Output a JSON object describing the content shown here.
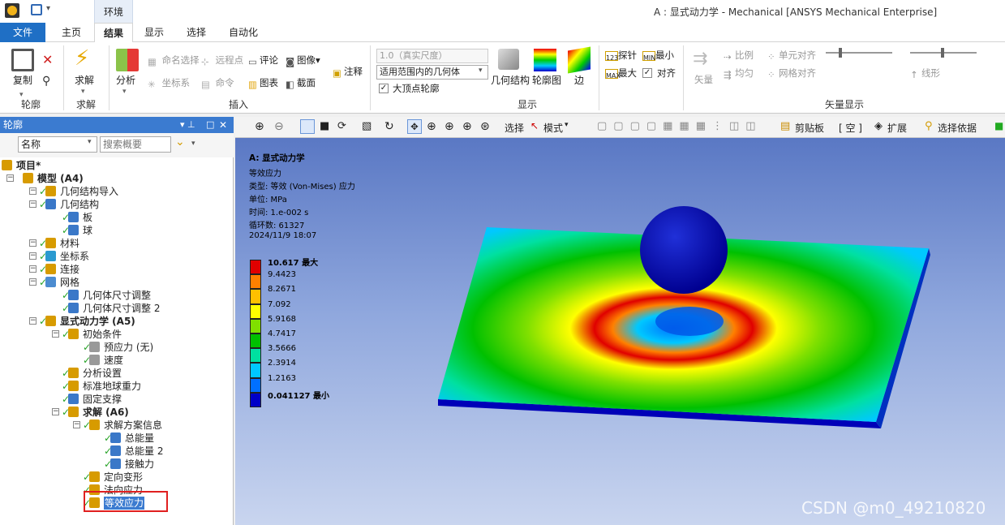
{
  "window": {
    "title": "A : 显式动力学 - Mechanical [ANSYS Mechanical Enterprise]",
    "context_tab": "环境"
  },
  "tabs": [
    "文件",
    "主页",
    "结果",
    "显示",
    "选择",
    "自动化"
  ],
  "ribbon": {
    "copy": "复制",
    "solve": "求解",
    "analyze": "分析",
    "name_select": "命名选择",
    "remote_point": "远程点",
    "comment": "评论",
    "image": "图像",
    "coord": "坐标系",
    "command": "命令",
    "chart": "图表",
    "screenshot": "截面",
    "annotation": "注释",
    "scale_value": "1.0（真实尺度）",
    "scope_value": "适用范围内的几何体",
    "outline_check": "大顶点轮廓",
    "geometry": "几何结构",
    "contour": "轮廓图",
    "edge": "边",
    "probe": "探针",
    "min": "最小",
    "max": "最大",
    "align": "对齐",
    "vector": "矢量",
    "ratio": "比例",
    "uniform": "均匀",
    "element_align": "单元对齐",
    "mesh_align": "网格对齐",
    "linear": "线形",
    "groups": [
      "轮廓",
      "求解",
      "插入",
      "显示",
      "矢量显示"
    ]
  },
  "outline": {
    "title": "轮廓",
    "filter_name": "名称",
    "search_placeholder": "搜索概要",
    "tree": [
      {
        "label": "项目*",
        "bold": true
      },
      {
        "label": "模型 (A4)",
        "bold": true
      },
      {
        "label": "几何结构导入"
      },
      {
        "label": "几何结构"
      },
      {
        "label": "板"
      },
      {
        "label": "球"
      },
      {
        "label": "材料"
      },
      {
        "label": "坐标系"
      },
      {
        "label": "连接"
      },
      {
        "label": "网格"
      },
      {
        "label": "几何体尺寸调整"
      },
      {
        "label": "几何体尺寸调整 2"
      },
      {
        "label": "显式动力学 (A5)",
        "bold": true
      },
      {
        "label": "初始条件"
      },
      {
        "label": "预应力 (无)"
      },
      {
        "label": "速度"
      },
      {
        "label": "分析设置"
      },
      {
        "label": "标准地球重力"
      },
      {
        "label": "固定支撑"
      },
      {
        "label": "求解 (A6)",
        "bold": true
      },
      {
        "label": "求解方案信息"
      },
      {
        "label": "总能量"
      },
      {
        "label": "总能量 2"
      },
      {
        "label": "接触力"
      },
      {
        "label": "定向变形"
      },
      {
        "label": "法向应力"
      },
      {
        "label": "等效应力",
        "selected": true
      }
    ]
  },
  "toolbar": {
    "select": "选择",
    "mode": "模式",
    "clipboard": "剪贴板",
    "empty": "[ 空 ]",
    "expand": "扩展",
    "select_by": "选择依据"
  },
  "result": {
    "title": "A: 显式动力学",
    "name": "等效应力",
    "type": "类型: 等效 (Von-Mises) 应力",
    "unit": "单位: MPa",
    "time": "时间: 1.e-002 s",
    "cycles": "循环数: 61327",
    "date": "2024/11/9 18:07"
  },
  "legend": {
    "labels": [
      "10.617 最大",
      "9.4423",
      "8.2671",
      "7.092",
      "5.9168",
      "4.7417",
      "3.5666",
      "2.3914",
      "1.2163",
      "0.041127 最小"
    ],
    "colors": [
      "#e00000",
      "#ff8000",
      "#ffc000",
      "#ffff00",
      "#80e000",
      "#00c000",
      "#00e0a0",
      "#00c8ff",
      "#0070ff",
      "#0000c8"
    ]
  },
  "watermark": "CSDN @m0_49210820"
}
